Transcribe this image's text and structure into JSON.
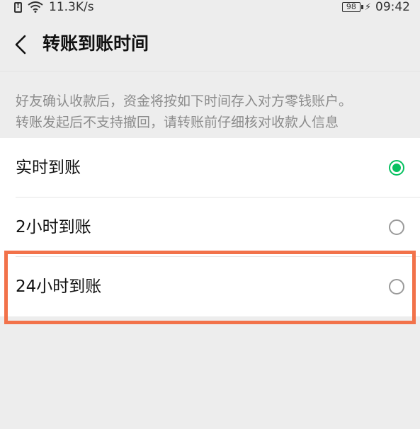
{
  "status_bar": {
    "network_speed": "11.3K/s",
    "battery_level": "98",
    "time": "09:42",
    "icons": [
      "alert-icon",
      "wifi-icon",
      "battery-icon",
      "charging-icon"
    ]
  },
  "nav": {
    "back_icon": "chevron-left-icon",
    "title": "转账到账时间"
  },
  "description": {
    "line1": "好友确认收款后，资金将按如下时间存入对方零钱账户。",
    "line2": "转账发起后不支持撤回，请转账前仔细核对收款人信息"
  },
  "options": [
    {
      "label": "实时到账",
      "selected": true
    },
    {
      "label": "2小时到账",
      "selected": false
    },
    {
      "label": "24小时到账",
      "selected": false
    }
  ],
  "colors": {
    "accent": "#07c160",
    "highlight": "#f2724a",
    "background": "#ededed"
  }
}
